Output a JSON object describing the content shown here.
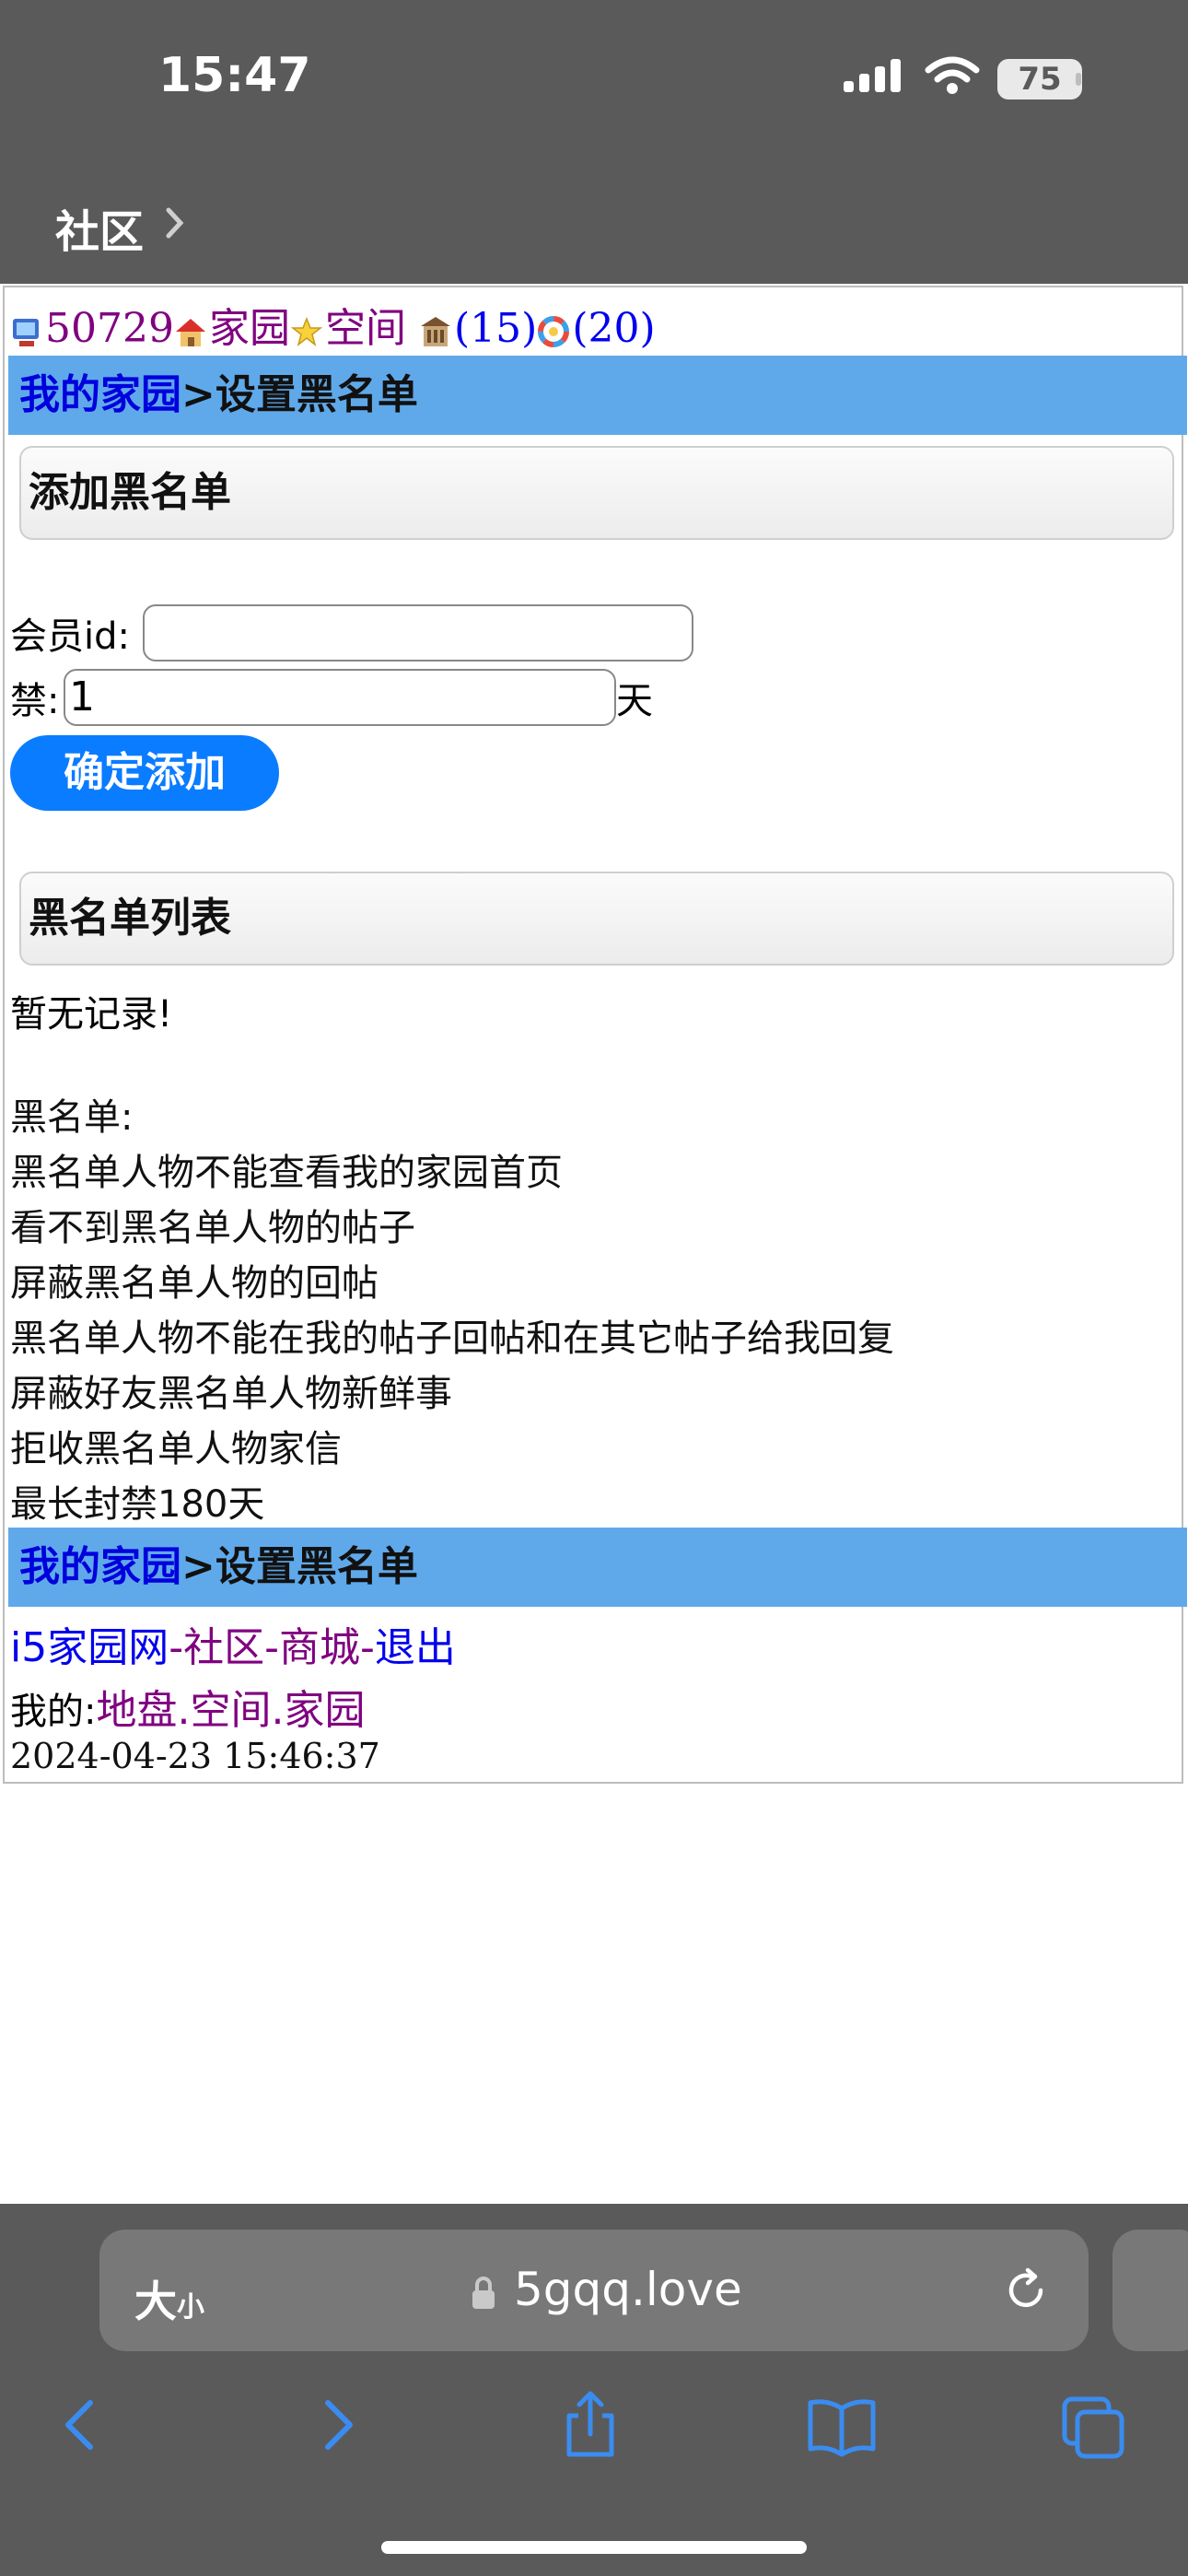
{
  "status_bar": {
    "time": "15:47",
    "battery": "75"
  },
  "nav": {
    "back_title": "社区"
  },
  "stats": {
    "points": "50729",
    "home_link": "家园",
    "space_link": "空间",
    "count1": "(15)",
    "count2": "(20)"
  },
  "breadcrumb": {
    "home": "我的家园",
    "separator": ">",
    "current": "设置黑名单"
  },
  "add_section": {
    "title": "添加黑名单",
    "member_id_label": "会员id:",
    "member_id_value": "",
    "ban_label": "禁:",
    "ban_value": "1",
    "ban_unit": "天",
    "submit_label": "确定添加"
  },
  "list_section": {
    "title": "黑名单列表",
    "empty_text": "暂无记录!"
  },
  "rules": {
    "heading": "黑名单:",
    "items": [
      "黑名单人物不能查看我的家园首页",
      "看不到黑名单人物的帖子",
      "屏蔽黑名单人物的回帖",
      "黑名单人物不能在我的帖子回帖和在其它帖子给我回复",
      "屏蔽好友黑名单人物新鲜事",
      "拒收黑名单人物家信",
      "最长封禁180天"
    ]
  },
  "footer": {
    "site_link": "i5家园网",
    "community_link": "社区",
    "mall_link": "商城",
    "logout_link": "退出",
    "dash": "-",
    "my_label": "我的:",
    "territory_link": "地盘",
    "space_link": "空间",
    "home_link": "家园",
    "dot": ".",
    "timestamp": "2024-04-23 15:46:37"
  },
  "browser": {
    "text_size_label": "大",
    "text_size_small": "小",
    "url": "5gqq.love"
  },
  "colors": {
    "chrome": "#5a5a5a",
    "bar_blue": "#5fa9ea",
    "link_blue": "#0000ee",
    "visited": "#800080",
    "button_blue": "#0a7cff"
  }
}
